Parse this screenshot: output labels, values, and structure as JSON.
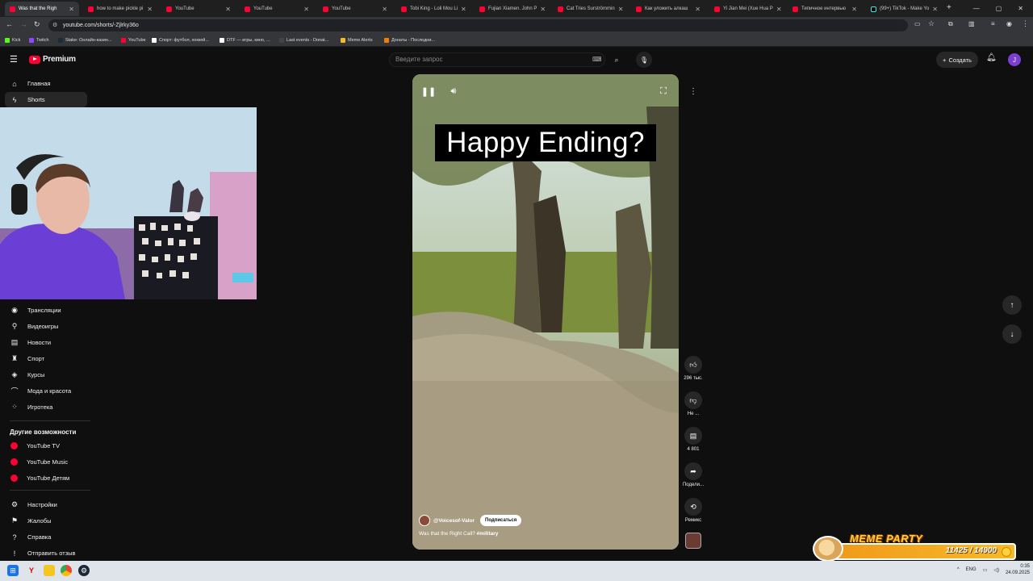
{
  "browser": {
    "tabs": [
      {
        "title": "Was that the Righ",
        "icon": "youtube-favicon",
        "active": true
      },
      {
        "title": "how to make pickle pi",
        "icon": "youtube-favicon"
      },
      {
        "title": "YouTube",
        "icon": "youtube-favicon"
      },
      {
        "title": "YouTube",
        "icon": "youtube-favicon"
      },
      {
        "title": "YouTube",
        "icon": "youtube-favicon"
      },
      {
        "title": "Tobi King - Loli Mou Li",
        "icon": "youtube-favicon"
      },
      {
        "title": "Fujian Xiamen. John P",
        "icon": "youtube-favicon"
      },
      {
        "title": "Cat Tries Surströmmin",
        "icon": "youtube-favicon"
      },
      {
        "title": "Как уложить алкаш",
        "icon": "youtube-favicon"
      },
      {
        "title": "Yi Jian Mei (Xue Hua P",
        "icon": "youtube-favicon"
      },
      {
        "title": "Типичное интервью",
        "icon": "youtube-favicon"
      },
      {
        "title": "(99+) TikTok - Make Yo",
        "icon": "tiktok-favicon"
      }
    ],
    "new_tab_label": "+",
    "url": "youtube.com/shorts/-Zjlrky36o",
    "bookmarks": [
      {
        "label": "Kick",
        "color": "#53fc18"
      },
      {
        "label": "Twitch",
        "color": "#9146ff"
      },
      {
        "label": "Stake: Онлайн-казин...",
        "color": "#1a2c38"
      },
      {
        "label": "YouTube",
        "color": "#ff0033"
      },
      {
        "label": "Спорт: футбол, хоккей...",
        "color": "#ffffff"
      },
      {
        "label": "DTF — игры, кино, ...",
        "color": "#ffffff"
      },
      {
        "label": "Last events - Donat...",
        "color": "#444444"
      },
      {
        "label": "Meme Alerts",
        "color": "#f6b92a"
      },
      {
        "label": "Донаты - Последни...",
        "color": "#f57d07"
      }
    ]
  },
  "youtube": {
    "logo_text": "Premium",
    "search_placeholder": "Введите запрос",
    "create_label": "Создать",
    "avatar_letter": "J",
    "sidebar": {
      "top_items": [
        {
          "label": "Главная",
          "icon": "home-icon"
        },
        {
          "label": "Shorts",
          "icon": "shorts-icon",
          "active": true
        }
      ],
      "explore_items": [
        {
          "label": "Трансляции",
          "icon": "live-icon"
        },
        {
          "label": "Видеоигры",
          "icon": "gamepad-icon"
        },
        {
          "label": "Новости",
          "icon": "news-icon"
        },
        {
          "label": "Спорт",
          "icon": "trophy-icon"
        },
        {
          "label": "Курсы",
          "icon": "courses-icon"
        },
        {
          "label": "Мода и красота",
          "icon": "hanger-icon"
        },
        {
          "label": "Игротека",
          "icon": "playables-icon"
        }
      ],
      "more_heading": "Другие возможности",
      "more_items": [
        {
          "label": "YouTube TV",
          "icon": "youtube-tv-icon"
        },
        {
          "label": "YouTube Music",
          "icon": "youtube-music-icon"
        },
        {
          "label": "YouTube Детям",
          "icon": "youtube-kids-icon"
        }
      ],
      "bottom_items": [
        {
          "label": "Настройки",
          "icon": "gear-icon"
        },
        {
          "label": "Жалобы",
          "icon": "flag-icon"
        },
        {
          "label": "Справка",
          "icon": "help-icon"
        },
        {
          "label": "Отправить отзыв",
          "icon": "feedback-icon"
        }
      ]
    },
    "short": {
      "caption_overlay": "Happy Ending?",
      "channel": "@Voicesof-Valor",
      "subscribe_label": "Подписаться",
      "title": "Was that the Right Call?",
      "hashtag": "#military"
    },
    "actions": {
      "like_count": "296 тыс.",
      "dislike_label": "Не ...",
      "comment_count": "4 801",
      "share_label": "Подели...",
      "remix_label": "Ремикс"
    }
  },
  "meme_party": {
    "title": "MEME PARTY",
    "progress_text": "11425 / 14900",
    "progress_fraction": 0.767
  },
  "system": {
    "language": "ENG",
    "time": "0:35",
    "date": "24.09.2025"
  },
  "colors": {
    "accent": "#ff0033",
    "background": "#0f0f0f",
    "avatar": "#7b3fd0"
  }
}
